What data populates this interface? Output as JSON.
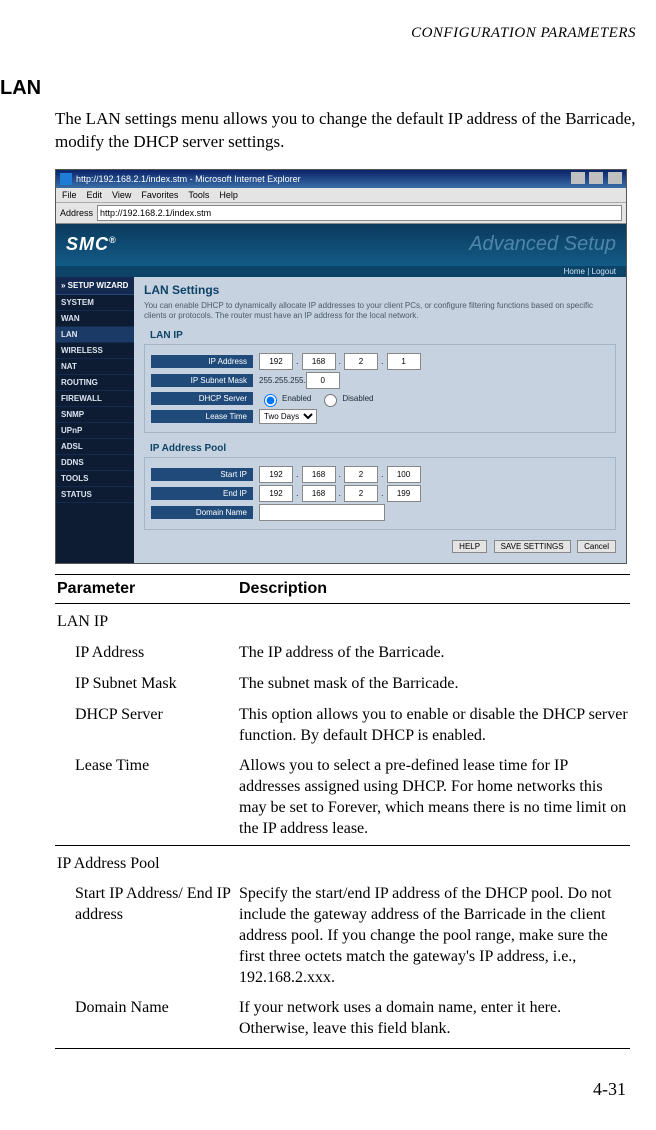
{
  "running_head": "CONFIGURATION PARAMETERS",
  "section_title": "LAN",
  "intro_text": "The LAN settings menu allows you to change the default IP address of the Barricade, modify the DHCP server settings.",
  "page_number": "4-31",
  "screenshot": {
    "window_title": "http://192.168.2.1/index.stm - Microsoft Internet Explorer",
    "menu": [
      "File",
      "Edit",
      "View",
      "Favorites",
      "Tools",
      "Help"
    ],
    "address_label": "Address",
    "address_url": "http://192.168.2.1/index.stm",
    "logo_text": "SMC",
    "logo_sup": "®",
    "banner_right": "Advanced Setup",
    "subbanner": "Home  |  Logout",
    "sidebar_header": "» SETUP WIZARD",
    "sidebar_items": [
      "SYSTEM",
      "WAN",
      "LAN",
      "WIRELESS",
      "NAT",
      "ROUTING",
      "FIREWALL",
      "SNMP",
      "UPnP",
      "ADSL",
      "DDNS",
      "TOOLS",
      "STATUS"
    ],
    "content_heading": "LAN Settings",
    "content_desc": "You can enable DHCP to dynamically allocate IP addresses to your client PCs, or configure filtering functions based on specific clients or protocols. The router must have an IP address for the local network.",
    "lan_ip": {
      "panel_label": "LAN IP",
      "rows": {
        "ip_label": "IP Address",
        "ip_octets": [
          "192",
          "168",
          "2",
          "1"
        ],
        "mask_label": "IP Subnet Mask",
        "mask_value": "255.255.255.",
        "mask_last": "0",
        "dhcp_label": "DHCP Server",
        "dhcp_enabled": "Enabled",
        "dhcp_disabled": "Disabled",
        "lease_label": "Lease Time",
        "lease_value": "Two Days"
      }
    },
    "pool": {
      "panel_label": "IP Address Pool",
      "start_label": "Start IP",
      "start_octets": [
        "192",
        "168",
        "2",
        "100"
      ],
      "end_label": "End IP",
      "end_octets": [
        "192",
        "168",
        "2",
        "199"
      ],
      "domain_label": "Domain Name",
      "domain_value": ""
    },
    "buttons": {
      "help": "HELP",
      "save": "SAVE SETTINGS",
      "cancel": "Cancel"
    }
  },
  "table": {
    "headers": {
      "param": "Parameter",
      "desc": "Description"
    },
    "rows": [
      {
        "type": "section",
        "param": "LAN IP",
        "desc": ""
      },
      {
        "type": "sub",
        "param": "IP Address",
        "desc": "The IP address of the Barricade."
      },
      {
        "type": "sub",
        "param": "IP Subnet Mask",
        "desc": "The subnet mask of the Barricade."
      },
      {
        "type": "sub",
        "param": "DHCP Server",
        "desc": "This option allows you to enable or disable the DHCP server function. By default DHCP is enabled."
      },
      {
        "type": "sub",
        "param": "Lease Time",
        "desc": "Allows you to select a pre-defined lease time for IP addresses assigned using DHCP. For home networks this may be set to Forever, which means there is no time limit on the IP address lease."
      },
      {
        "type": "section-divider",
        "param": "IP Address Pool",
        "desc": ""
      },
      {
        "type": "sub",
        "param": "Start IP Address/ End IP address",
        "desc": "Specify the start/end IP address of the DHCP pool. Do not include the gateway address of the Barricade in the client address pool. If you change the pool range, make sure the first three octets match the gateway's IP address, i.e., 192.168.2.xxx."
      },
      {
        "type": "sub-last",
        "param": "Domain Name",
        "desc": "If your network uses a domain name, enter it here. Otherwise, leave this field blank."
      }
    ]
  }
}
